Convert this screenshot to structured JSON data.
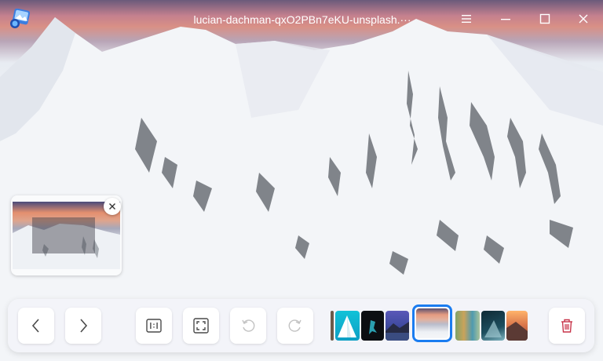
{
  "window": {
    "title": "lucian-dachman-qxO2PBn7eKU-unsplash.···",
    "app_icon": "image-viewer-icon",
    "buttons": [
      "menu-icon",
      "minimize-icon",
      "maximize-icon",
      "close-icon"
    ]
  },
  "navigator": {
    "close_icon": "close-icon"
  },
  "toolbar": {
    "buttons": [
      {
        "name": "previous-button",
        "icon": "chevron-left-icon"
      },
      {
        "name": "next-button",
        "icon": "chevron-right-icon"
      },
      {
        "name": "original-size-button",
        "icon": "one-to-one-icon"
      },
      {
        "name": "fit-window-button",
        "icon": "fit-screen-icon"
      },
      {
        "name": "rotate-counterclockwise-button",
        "icon": "rotate-left-icon"
      },
      {
        "name": "rotate-clockwise-button",
        "icon": "rotate-right-icon"
      },
      {
        "name": "delete-button",
        "icon": "trash-icon"
      }
    ],
    "thumbnail_count": 9,
    "current_thumbnail": 5,
    "colors": {
      "accent": "#1a7cf0",
      "delete": "#c8354a"
    }
  }
}
